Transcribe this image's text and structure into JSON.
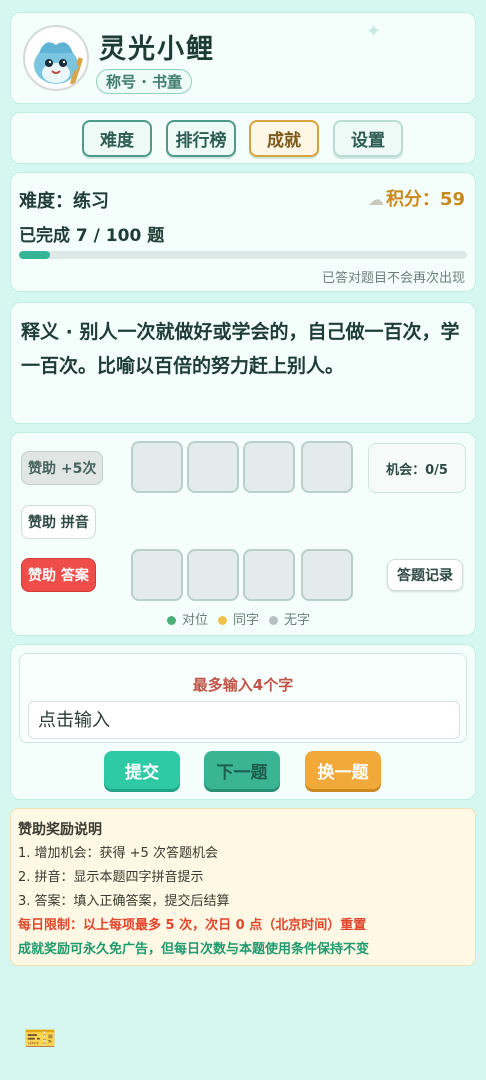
{
  "profile": {
    "nickname": "灵光小鲤",
    "title_label": "称号 · 书童"
  },
  "nav": {
    "difficulty": "难度",
    "leaderboard": "排行榜",
    "achievements": "成就",
    "settings": "设置"
  },
  "status": {
    "difficulty_text": "难度：练习",
    "score_text": "积分：59",
    "progress_text": "已完成 7 / 100 题",
    "progress_fraction": 0.07,
    "hint": "已答对题目不会再次出现"
  },
  "definition": {
    "text": "释义 · 别人一次就做好或学会的，自己做一百次，学一百次。比喻以百倍的努力赶上别人。"
  },
  "game": {
    "help_plus5": "赞助 +5次",
    "help_pinyin": "赞助 拼音",
    "help_answer": "赞助 答案",
    "chances": "机会：0/5",
    "record": "答题记录",
    "legend": {
      "correct": "对位",
      "same": "同字",
      "none": "无字"
    }
  },
  "input": {
    "limit": "最多输入4个字",
    "placeholder": "点击输入",
    "submit": "提交",
    "next": "下一题",
    "swap": "换一题"
  },
  "rules": {
    "title": "赞助奖励说明",
    "line1": "1. 增加机会：获得 +5 次答题机会",
    "line2": "2. 拼音：显示本题四字拼音提示",
    "line3": "3. 答案：填入正确答案，提交后结算",
    "limit": "每日限制：以上每项最多 5 次，次日 0 点（北京时间）重置",
    "ads": "成就奖励可永久免广告，但每日次数与本题使用条件保持不变"
  },
  "colors": {
    "accent": "#2ec9a5",
    "correct_dot": "#4caf7a",
    "same_dot": "#f1c24e",
    "none_dot": "#b6c1bf",
    "danger": "#ef4d4a",
    "score": "#c98a1c"
  },
  "icons": [
    "fish-mascot-avatar",
    "cloud-icon",
    "ticket-icon"
  ]
}
